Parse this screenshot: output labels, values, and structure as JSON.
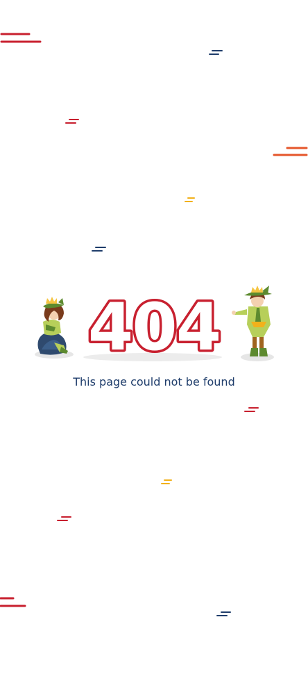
{
  "error": {
    "code": "404",
    "message": "This page could not be found"
  },
  "colors": {
    "red": "#c8202f",
    "orange": "#e5562b",
    "navy": "#1f3d6b",
    "yellow": "#f2b11b",
    "shadow": "#e6e6e6",
    "hair": "#7a3b1c",
    "leaf_green": "#5d8a2f",
    "tunic": "#b7cf5a",
    "crown": "#f5c542"
  },
  "icons": [
    "sitting-elf-character",
    "standing-elf-character",
    "speed-dash-decoration"
  ]
}
